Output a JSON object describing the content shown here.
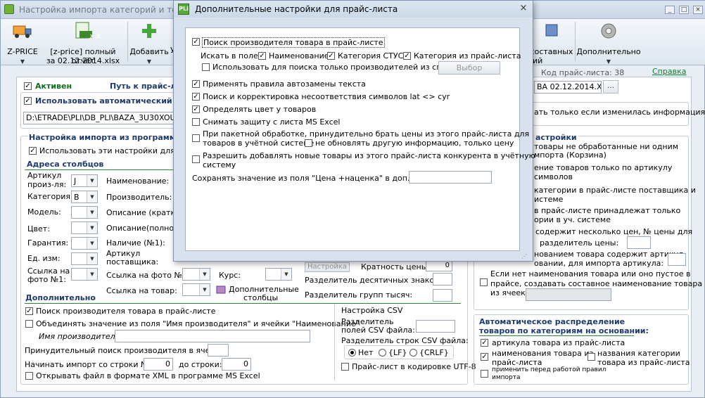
{
  "window": {
    "title": "Настройка импорта категорий и товаро"
  },
  "toolbar": {
    "zprice": "Z-PRICE",
    "report_line1": "[z-price] полный отчёт",
    "report_line2": "за 02.12.2014.xlsx",
    "add": "Добавить",
    "add_tail": "У",
    "composite_line1": "составных",
    "composite_line2": "ий",
    "extra": "Дополнительно",
    "xls_badge": "XLS"
  },
  "header": {
    "active": "Активен",
    "path_label": "Путь к прайс-ли",
    "price_code": "Код прайс-листа: 38",
    "help": "Справка",
    "auto_label": "Использовать автоматический им",
    "path_value": "D:\\ETRADE\\PLI\\DB_PLI\\BAZA_3U30XOU08\\",
    "file_value": "BA 02.12.2014.XLS",
    "browse": "...",
    "only_changed": "ать только если изменилась информация"
  },
  "import_group": {
    "title": "Настройка импорта из программы М",
    "use_all": "Использовать эти настройки для все:"
  },
  "columns": {
    "title": "Адреса столбцов",
    "article_l1": "Артикул",
    "article_l2": "произ-ля:",
    "article_val": "J",
    "category": "Категория:",
    "category_val": "B",
    "model": "Модель:",
    "color": "Цвет:",
    "warranty": "Гарантия:",
    "unit": "Ед. изм:",
    "photo1_l1": "Ссылка на",
    "photo1_l2": "фото №1:",
    "name": "Наименование:",
    "producer": "Производитель:",
    "desc_short": "Описание (краткое",
    "desc_full": "Описание(полное):",
    "avail": "Наличие (№1):",
    "supplier_l1": "Артикул",
    "supplier_l2": "поставщика:",
    "photo2": "Ссылка на фото №2:",
    "goods_link": "Ссылка на товар:",
    "course": "Курс:",
    "extra_cols_l1": "Дополнительные",
    "extra_cols_l2": "столбцы",
    "setting_btn": "Настройка",
    "multiplicity": "Кратность цены",
    "multiplicity_val": "0",
    "dec_sep": "Разделитель десятичных знаков:",
    "thou_sep": "Разделитель групп тысяч:"
  },
  "additional": {
    "title": "Дополнительно",
    "search_producer": "Поиск производителя товара в прайс-листе",
    "merge": "Объединять значение из поля \"Имя производителя\" и ячейки \"Наименование\"",
    "producer_name": "Имя производителя:",
    "forced_search": "Принудительный поиск производителя в ячейке:",
    "start_row": "Начинать импорт со строки №:",
    "start_val": "0",
    "to_row": "до строки:",
    "to_val": "0",
    "open_xml": "Открывать файл в формате XML в программе MS Excel"
  },
  "csv": {
    "title": "Настройка CSV",
    "field_sep_l1": "Разделитель",
    "field_sep_l2": "полей CSV файла:",
    "row_sep": "Разделитель строк CSV файла:",
    "opt_none": "Нет",
    "opt_lf": "{LF}",
    "opt_crlf": "{CRLF}",
    "utf8": "Прайс-лист в кодировке UTF-8"
  },
  "right": {
    "title": "астройки",
    "r1_l1": "товары не обработанные ни одним",
    "r1_l2": "мпорта (Корзина)",
    "r2_l1": "ение товаров только по артикулу",
    "r2_l2": "символов",
    "r3_l1": "категории в прайс-листе поставщика и",
    "r3_l2": "истеме",
    "r4_l1": "в прайс-листе принадлежат только",
    "r4_l2": "ории в уч. системе",
    "r5": "содержит несколько цен, № цены для",
    "r5_sep": "разделитель цены:",
    "r6_l1": "нованием товара содержит артикул,",
    "r6_l2": "овании, для импорта артикула:",
    "r7_l1": "Если нет наименования товара или оно пустое в",
    "r7_l2": "прайсе, создавать составное наименование товара",
    "r7_l3": "из ячеек:"
  },
  "autodist": {
    "title_l1": "Автоматическое распределение",
    "title_l2": "товаров по категориям на основании:",
    "by_article": "артикула товара из прайс-листа",
    "by_name_l1": "наименования товара из",
    "by_name_l2": "прайс-листа",
    "by_cat_l1": "названия  категории",
    "by_cat_l2": "товара из прайс-листа",
    "apply_l1": "применить перед работой правил",
    "apply_l2": "импорта"
  },
  "dialog": {
    "title": "Дополнительные настройки для прайс-листа",
    "icon": "PLi",
    "search_producer": "Поиск производителя товара в прайс-листе",
    "search_in": "Искать в поле:",
    "f_name": "Наименование",
    "f_stus": "Категория СТУС",
    "f_cat": "Категория из прайс-листа",
    "only_list": "Использовать для поиска только производителей из списка",
    "choose": "Выбор",
    "autoreplace": "Применять правила автозамены текста",
    "latcyr": "Поиск и корректировка несоответствия символов lat <> cyr",
    "color": "Определять цвет у товаров",
    "unprotect": "Снимать защиту с листа MS Excel",
    "batch_l1": "При пакетной обработке, принудительно брать цены из этого прайс-листа для",
    "batch_l2": "товаров в учётной системе",
    "no_update": "не обновлять другую информацию, только цену",
    "allow_new_l1": "Разрешить добавлять новые товары из этого прайс-листа конкурента в учётную",
    "allow_new_l2": "систему",
    "save_markup": "Сохранять значение из поля \"Цена +наценка\" в доп. поле:"
  }
}
